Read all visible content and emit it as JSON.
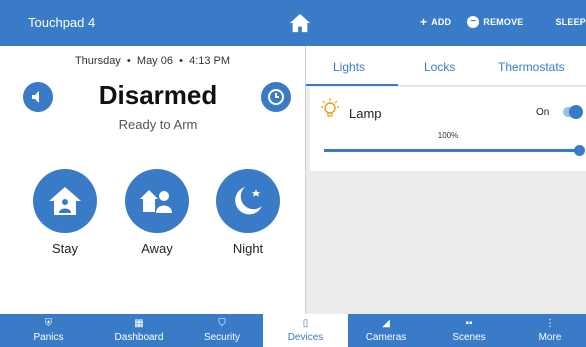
{
  "topbar": {
    "title": "Touchpad 4",
    "actions": {
      "add": "ADD",
      "remove": "REMOVE",
      "sleep": "SLEEP"
    }
  },
  "security": {
    "date": "Thursday",
    "month_day": "May 06",
    "time": "4:13 PM",
    "status": "Disarmed",
    "substatus": "Ready to Arm",
    "arm_buttons": {
      "stay": "Stay",
      "away": "Away",
      "night": "Night"
    }
  },
  "devices": {
    "tabs": [
      "Lights",
      "Locks",
      "Thermostats"
    ],
    "active_tab": "Lights",
    "lights": [
      {
        "name": "Lamp",
        "state": "On",
        "level": "100%",
        "level_value": 100
      }
    ]
  },
  "bottom_nav": [
    {
      "label": "Panics",
      "icon": "panic-shield-icon",
      "active": false
    },
    {
      "label": "Dashboard",
      "icon": "dashboard-icon",
      "active": false
    },
    {
      "label": "Security",
      "icon": "security-shield-icon",
      "active": false
    },
    {
      "label": "Devices",
      "icon": "devices-icon",
      "active": true
    },
    {
      "label": "Cameras",
      "icon": "camera-icon",
      "active": false
    },
    {
      "label": "Scenes",
      "icon": "scenes-icon",
      "active": false
    },
    {
      "label": "More",
      "icon": "more-vertical-icon",
      "active": false
    }
  ],
  "colors": {
    "primary": "#3a7bc8",
    "panel_gray": "#ececec"
  }
}
